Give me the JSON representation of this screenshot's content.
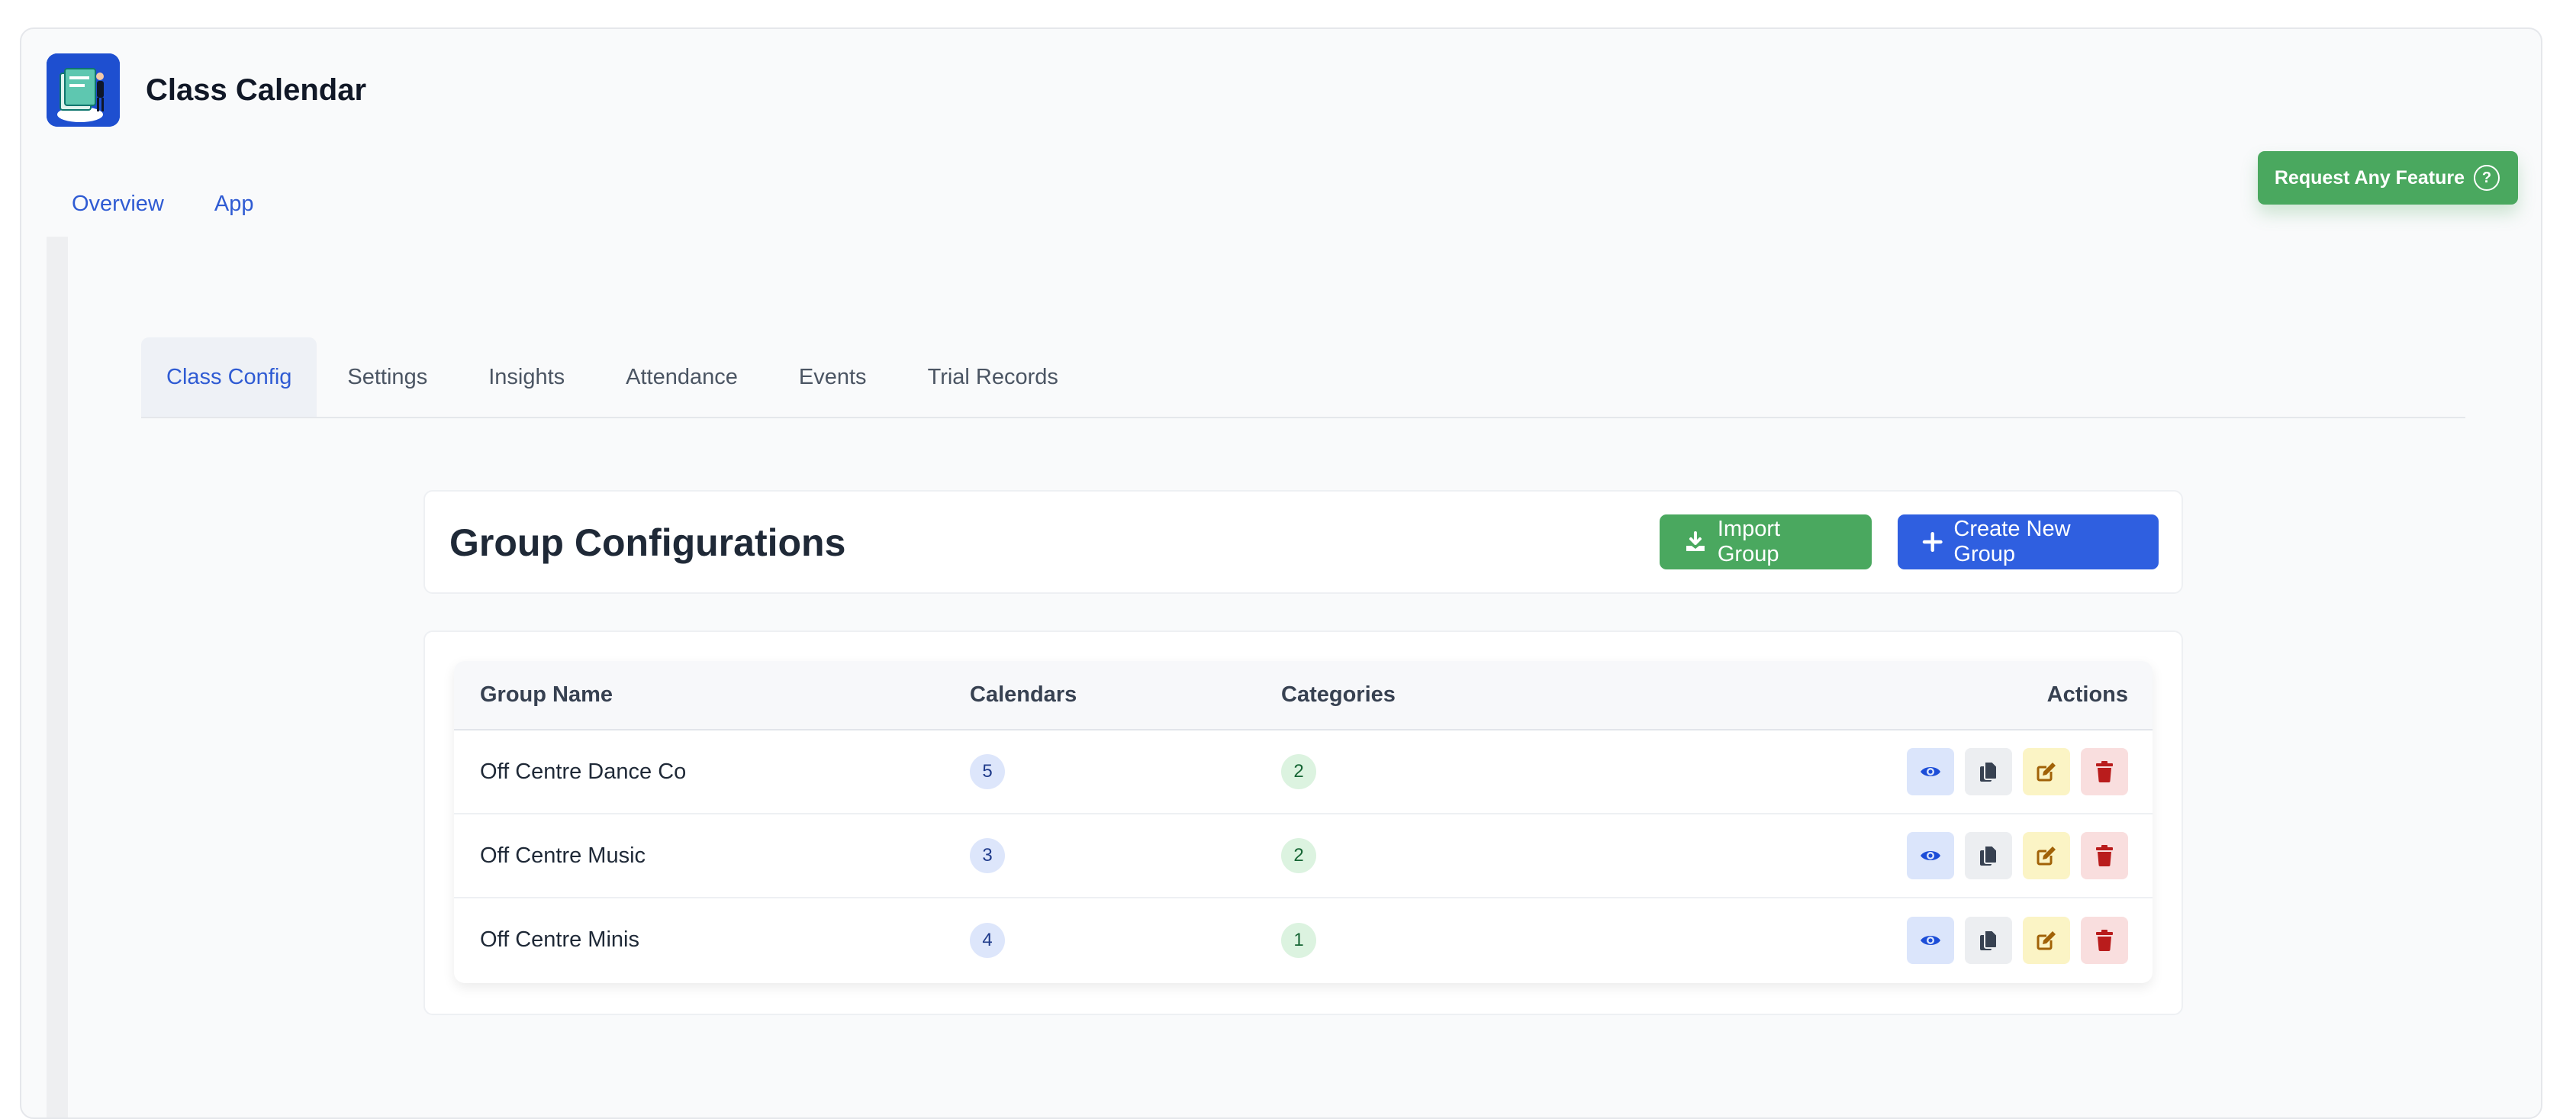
{
  "app": {
    "title": "Class Calendar"
  },
  "top_tabs": [
    {
      "label": "Overview"
    },
    {
      "label": "App"
    }
  ],
  "feature_button": {
    "label": "Request Any Feature",
    "icon": "question-circle-icon"
  },
  "sub_tabs": [
    {
      "label": "Class Config"
    },
    {
      "label": "Settings"
    },
    {
      "label": "Insights"
    },
    {
      "label": "Attendance"
    },
    {
      "label": "Events"
    },
    {
      "label": "Trial Records"
    }
  ],
  "page": {
    "heading": "Group Configurations",
    "import_label": "Import Group",
    "create_label": "Create New Group"
  },
  "table": {
    "headers": [
      "Group Name",
      "Calendars",
      "Categories",
      "Actions"
    ],
    "rows": [
      {
        "name": "Off Centre Dance Co",
        "calendars": "5",
        "categories": "2"
      },
      {
        "name": "Off Centre Music",
        "calendars": "3",
        "categories": "2"
      },
      {
        "name": "Off Centre Minis",
        "calendars": "4",
        "categories": "1"
      }
    ]
  },
  "colors": {
    "accent_blue": "#2f5fe0",
    "accent_green": "#4aa85f",
    "danger_red": "#b91c1c",
    "edit_amber": "#a16207"
  }
}
